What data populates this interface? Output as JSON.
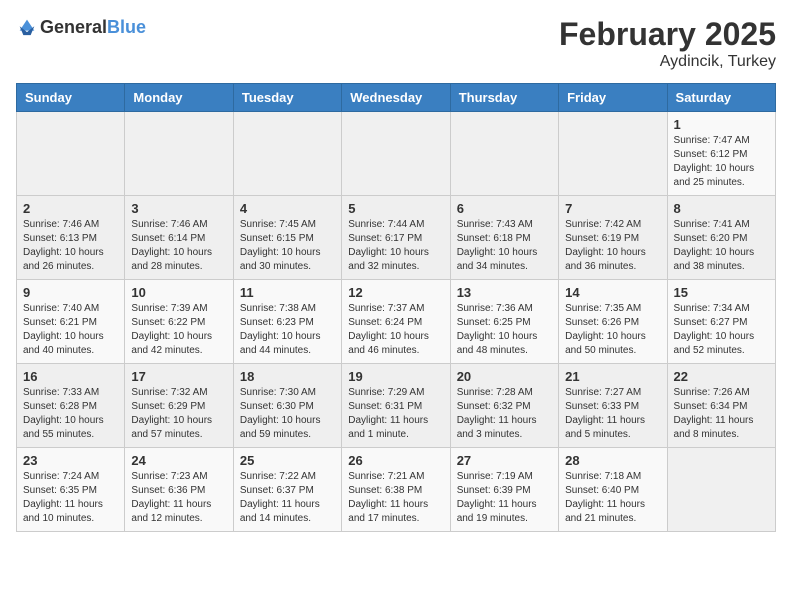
{
  "header": {
    "logo_general": "General",
    "logo_blue": "Blue",
    "month": "February 2025",
    "location": "Aydincik, Turkey"
  },
  "columns": [
    "Sunday",
    "Monday",
    "Tuesday",
    "Wednesday",
    "Thursday",
    "Friday",
    "Saturday"
  ],
  "weeks": [
    [
      {
        "day": "",
        "content": ""
      },
      {
        "day": "",
        "content": ""
      },
      {
        "day": "",
        "content": ""
      },
      {
        "day": "",
        "content": ""
      },
      {
        "day": "",
        "content": ""
      },
      {
        "day": "",
        "content": ""
      },
      {
        "day": "1",
        "content": "Sunrise: 7:47 AM\nSunset: 6:12 PM\nDaylight: 10 hours and 25 minutes."
      }
    ],
    [
      {
        "day": "2",
        "content": "Sunrise: 7:46 AM\nSunset: 6:13 PM\nDaylight: 10 hours and 26 minutes."
      },
      {
        "day": "3",
        "content": "Sunrise: 7:46 AM\nSunset: 6:14 PM\nDaylight: 10 hours and 28 minutes."
      },
      {
        "day": "4",
        "content": "Sunrise: 7:45 AM\nSunset: 6:15 PM\nDaylight: 10 hours and 30 minutes."
      },
      {
        "day": "5",
        "content": "Sunrise: 7:44 AM\nSunset: 6:17 PM\nDaylight: 10 hours and 32 minutes."
      },
      {
        "day": "6",
        "content": "Sunrise: 7:43 AM\nSunset: 6:18 PM\nDaylight: 10 hours and 34 minutes."
      },
      {
        "day": "7",
        "content": "Sunrise: 7:42 AM\nSunset: 6:19 PM\nDaylight: 10 hours and 36 minutes."
      },
      {
        "day": "8",
        "content": "Sunrise: 7:41 AM\nSunset: 6:20 PM\nDaylight: 10 hours and 38 minutes."
      }
    ],
    [
      {
        "day": "9",
        "content": "Sunrise: 7:40 AM\nSunset: 6:21 PM\nDaylight: 10 hours and 40 minutes."
      },
      {
        "day": "10",
        "content": "Sunrise: 7:39 AM\nSunset: 6:22 PM\nDaylight: 10 hours and 42 minutes."
      },
      {
        "day": "11",
        "content": "Sunrise: 7:38 AM\nSunset: 6:23 PM\nDaylight: 10 hours and 44 minutes."
      },
      {
        "day": "12",
        "content": "Sunrise: 7:37 AM\nSunset: 6:24 PM\nDaylight: 10 hours and 46 minutes."
      },
      {
        "day": "13",
        "content": "Sunrise: 7:36 AM\nSunset: 6:25 PM\nDaylight: 10 hours and 48 minutes."
      },
      {
        "day": "14",
        "content": "Sunrise: 7:35 AM\nSunset: 6:26 PM\nDaylight: 10 hours and 50 minutes."
      },
      {
        "day": "15",
        "content": "Sunrise: 7:34 AM\nSunset: 6:27 PM\nDaylight: 10 hours and 52 minutes."
      }
    ],
    [
      {
        "day": "16",
        "content": "Sunrise: 7:33 AM\nSunset: 6:28 PM\nDaylight: 10 hours and 55 minutes."
      },
      {
        "day": "17",
        "content": "Sunrise: 7:32 AM\nSunset: 6:29 PM\nDaylight: 10 hours and 57 minutes."
      },
      {
        "day": "18",
        "content": "Sunrise: 7:30 AM\nSunset: 6:30 PM\nDaylight: 10 hours and 59 minutes."
      },
      {
        "day": "19",
        "content": "Sunrise: 7:29 AM\nSunset: 6:31 PM\nDaylight: 11 hours and 1 minute."
      },
      {
        "day": "20",
        "content": "Sunrise: 7:28 AM\nSunset: 6:32 PM\nDaylight: 11 hours and 3 minutes."
      },
      {
        "day": "21",
        "content": "Sunrise: 7:27 AM\nSunset: 6:33 PM\nDaylight: 11 hours and 5 minutes."
      },
      {
        "day": "22",
        "content": "Sunrise: 7:26 AM\nSunset: 6:34 PM\nDaylight: 11 hours and 8 minutes."
      }
    ],
    [
      {
        "day": "23",
        "content": "Sunrise: 7:24 AM\nSunset: 6:35 PM\nDaylight: 11 hours and 10 minutes."
      },
      {
        "day": "24",
        "content": "Sunrise: 7:23 AM\nSunset: 6:36 PM\nDaylight: 11 hours and 12 minutes."
      },
      {
        "day": "25",
        "content": "Sunrise: 7:22 AM\nSunset: 6:37 PM\nDaylight: 11 hours and 14 minutes."
      },
      {
        "day": "26",
        "content": "Sunrise: 7:21 AM\nSunset: 6:38 PM\nDaylight: 11 hours and 17 minutes."
      },
      {
        "day": "27",
        "content": "Sunrise: 7:19 AM\nSunset: 6:39 PM\nDaylight: 11 hours and 19 minutes."
      },
      {
        "day": "28",
        "content": "Sunrise: 7:18 AM\nSunset: 6:40 PM\nDaylight: 11 hours and 21 minutes."
      },
      {
        "day": "",
        "content": ""
      }
    ]
  ]
}
